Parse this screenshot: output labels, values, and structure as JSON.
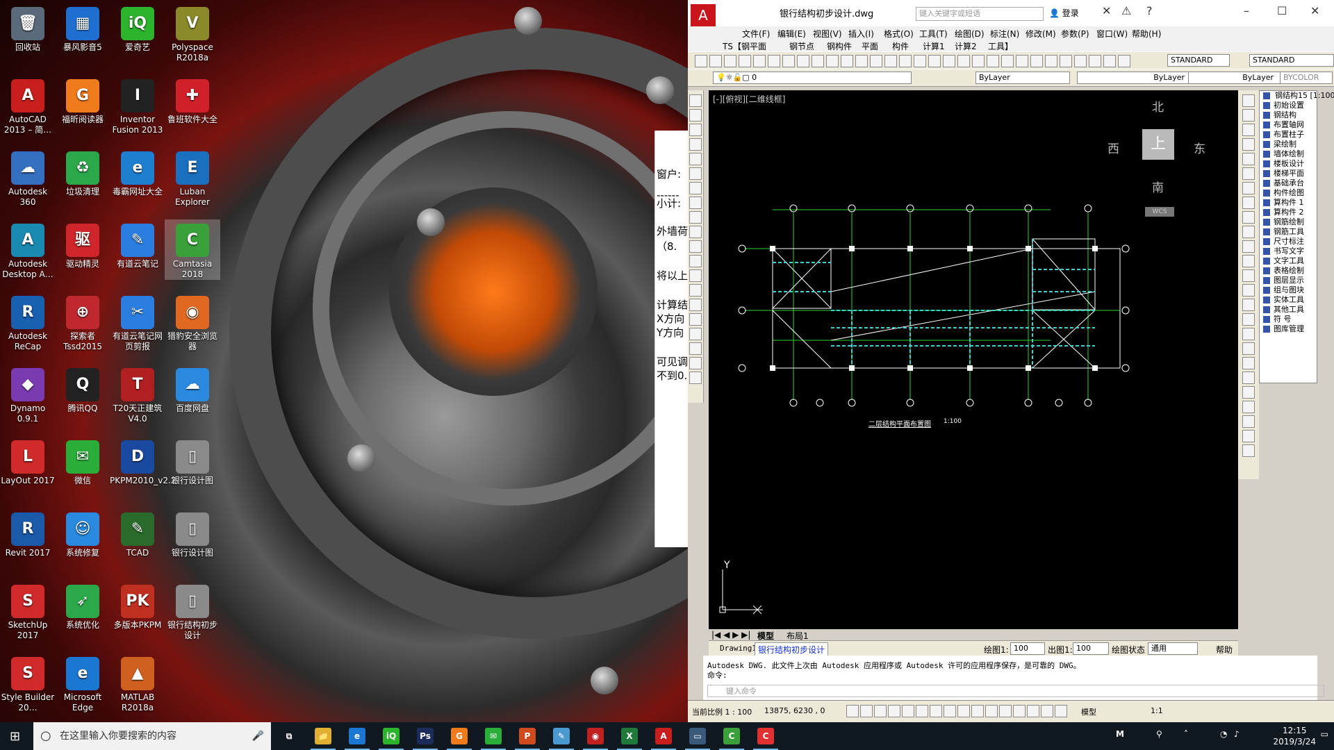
{
  "desktop": {
    "icons": [
      {
        "label": "回收站",
        "glyph": "🗑",
        "color": "#5a6a7a"
      },
      {
        "label": "暴风影音5",
        "glyph": "▦",
        "color": "#1e6fd0"
      },
      {
        "label": "爱奇艺",
        "glyph": "iQ",
        "color": "#2cb52c"
      },
      {
        "label": "Polyspace R2018a",
        "glyph": "V",
        "color": "#8a8a2a"
      },
      {
        "label": "AutoCAD 2013 – 简…",
        "glyph": "A",
        "color": "#c81e1e"
      },
      {
        "label": "福昕阅读器",
        "glyph": "G",
        "color": "#f07b1b"
      },
      {
        "label": "Inventor Fusion 2013",
        "glyph": "I",
        "color": "#222222"
      },
      {
        "label": "鲁班软件大全",
        "glyph": "✚",
        "color": "#d0202a"
      },
      {
        "label": "Autodesk 360",
        "glyph": "☁",
        "color": "#3570c0"
      },
      {
        "label": "垃圾清理",
        "glyph": "♻",
        "color": "#2aa84a"
      },
      {
        "label": "毒霸网址大全",
        "glyph": "e",
        "color": "#1e7fd0"
      },
      {
        "label": "Luban Explorer",
        "glyph": "E",
        "color": "#1a6fbf"
      },
      {
        "label": "Autodesk Desktop A…",
        "glyph": "A",
        "color": "#1a8ab0"
      },
      {
        "label": "驱动精灵",
        "glyph": "驱",
        "color": "#d0252a"
      },
      {
        "label": "有道云笔记",
        "glyph": "✎",
        "color": "#2b7ee0"
      },
      {
        "label": "Camtasia 2018",
        "glyph": "C",
        "color": "#3aa13a"
      },
      {
        "label": "Autodesk ReCap",
        "glyph": "R",
        "color": "#1960b0"
      },
      {
        "label": "探索者 Tssd2015",
        "glyph": "⊕",
        "color": "#c02830"
      },
      {
        "label": "有道云笔记网页剪报",
        "glyph": "✂",
        "color": "#2b7ee0"
      },
      {
        "label": "猎豹安全浏览器",
        "glyph": "◉",
        "color": "#e06820"
      },
      {
        "label": "Dynamo 0.9.1",
        "glyph": "◆",
        "color": "#7a3ab0"
      },
      {
        "label": "腾讯QQ",
        "glyph": "Q",
        "color": "#222222"
      },
      {
        "label": "T20天正建筑 V4.0",
        "glyph": "T",
        "color": "#b02020"
      },
      {
        "label": "百度网盘",
        "glyph": "☁",
        "color": "#2b8ae0"
      },
      {
        "label": "LayOut 2017",
        "glyph": "L",
        "color": "#d02a2a"
      },
      {
        "label": "微信",
        "glyph": "✉",
        "color": "#2aae3a"
      },
      {
        "label": "PKPM2010_v2.2",
        "glyph": "D",
        "color": "#1a4aa0"
      },
      {
        "label": "银行设计图",
        "glyph": "▯",
        "color": "#8a8a8a"
      },
      {
        "label": "Revit 2017",
        "glyph": "R",
        "color": "#1a5aa8"
      },
      {
        "label": "系统修复",
        "glyph": "☺",
        "color": "#2a8ae0"
      },
      {
        "label": "TCAD",
        "glyph": "✎",
        "color": "#2a6a2a"
      },
      {
        "label": "银行设计图",
        "glyph": "▯",
        "color": "#8a8a8a"
      },
      {
        "label": "SketchUp 2017",
        "glyph": "S",
        "color": "#d02a2a"
      },
      {
        "label": "系统优化",
        "glyph": "➶",
        "color": "#2aa84a"
      },
      {
        "label": "多版本PKPM",
        "glyph": "PK",
        "color": "#c03020"
      },
      {
        "label": "银行结构初步设计",
        "glyph": "▯",
        "color": "#8a8a8a"
      },
      {
        "label": "Style Builder 20…",
        "glyph": "S",
        "color": "#d02a2a"
      },
      {
        "label": "Microsoft Edge",
        "glyph": "e",
        "color": "#1a78d0"
      },
      {
        "label": "MATLAB R2018a",
        "glyph": "▲",
        "color": "#d06020"
      }
    ]
  },
  "side_window": {
    "lines": [
      "窗户:",
      "------",
      "小计:",
      "外墙荷",
      "（8.",
      "将以上",
      "计算结",
      "X方向",
      "Y方向",
      "可见调",
      "不到0."
    ]
  },
  "cad": {
    "title": "银行结构初步设计.dwg",
    "search_placeholder": "键入关键字或短语",
    "login_label": "登录",
    "menu": [
      "文件(F)",
      "编辑(E)",
      "视图(V)",
      "插入(I)",
      "格式(O)",
      "工具(T)",
      "绘图(D)",
      "标注(N)",
      "修改(M)",
      "参数(P)",
      "窗口(W)",
      "帮助(H)"
    ],
    "ts_menu": [
      "TS【钢平面",
      "钢节点",
      "钢构件",
      "平面",
      "构件",
      "计算1",
      "计算2",
      "工具】"
    ],
    "text_style": "STANDARD",
    "dim_style": "STANDARD",
    "layer": "0",
    "color": "ByLayer",
    "linetype": "ByLayer",
    "lineweight": "ByLayer",
    "plotstyle": "BYCOLOR",
    "view_label": "[-][俯视][二维线框]",
    "compass": {
      "n": "北",
      "s": "南",
      "e": "东",
      "w": "西",
      "top": "上"
    },
    "wcs": "WCS",
    "drawing_caption": "二层结构平面布置图",
    "drawing_scale": "1:100",
    "axis_y": "Y",
    "axis_x": "X",
    "tabs": [
      "模型",
      "布局1"
    ],
    "doc_tabs": [
      "Drawing1",
      "银行结构初步设计"
    ],
    "draw_scale_label": "绘图1:",
    "draw_scale_value": "100",
    "out_scale_label": "出图1:",
    "out_scale_value": "100",
    "draw_state_label": "绘图状态",
    "draw_state_value": "通用",
    "help_label": "帮助",
    "command_history": "Autodesk DWG. 此文件上次由 Autodesk 应用程序或 Autodesk 许可的应用程序保存，是可靠的 DWG。",
    "command_prompt": "命令:",
    "command_placeholder": "键入命令",
    "status_scale": "当前比例 1 : 100",
    "status_coords": "13875, 6230 , 0",
    "status_model": "模型",
    "status_anno": "1:1",
    "tpanel_title": "钢结构15 [1:100]",
    "tpanel_items": [
      "初始设置",
      "钢结构",
      "布置轴网",
      "布置柱子",
      "梁绘制",
      "墙体绘制",
      "楼板设计",
      "楼梯平面",
      "基础承台",
      "构件绘图",
      "算构件 1",
      "算构件 2",
      "钢筋绘制",
      "钢筋工具",
      "尺寸标注",
      "书写文字",
      "文字工具",
      "表格绘制",
      "图层显示",
      "组与图块",
      "实体工具",
      "其他工具",
      "符 号",
      "图库管理"
    ]
  },
  "taskbar": {
    "search_placeholder": "在这里输入你要搜索的内容",
    "apps": [
      {
        "name": "task-view",
        "glyph": "⧉",
        "color": "#101820"
      },
      {
        "name": "file-explorer",
        "glyph": "📁",
        "color": "#e0b030"
      },
      {
        "name": "edge",
        "glyph": "e",
        "color": "#1a78d0"
      },
      {
        "name": "iqiyi",
        "glyph": "iQ",
        "color": "#2cb52c"
      },
      {
        "name": "photoshop",
        "glyph": "Ps",
        "color": "#1b2c5a"
      },
      {
        "name": "foxit",
        "glyph": "G",
        "color": "#f07b1b"
      },
      {
        "name": "wechat",
        "glyph": "✉",
        "color": "#2aae3a"
      },
      {
        "name": "powerpoint",
        "glyph": "P",
        "color": "#d04a20"
      },
      {
        "name": "note",
        "glyph": "✎",
        "color": "#4a9ad0"
      },
      {
        "name": "browser",
        "glyph": "◉",
        "color": "#c02020"
      },
      {
        "name": "excel",
        "glyph": "X",
        "color": "#1f7a3a"
      },
      {
        "name": "autocad",
        "glyph": "A",
        "color": "#c81e1e"
      },
      {
        "name": "window",
        "glyph": "▭",
        "color": "#3a5a7a"
      },
      {
        "name": "camtasia",
        "glyph": "C",
        "color": "#3aa13a"
      },
      {
        "name": "camtasia-recorder",
        "glyph": "C",
        "color": "#e03030"
      }
    ],
    "time": "12:15",
    "date": "2019/3/24"
  }
}
